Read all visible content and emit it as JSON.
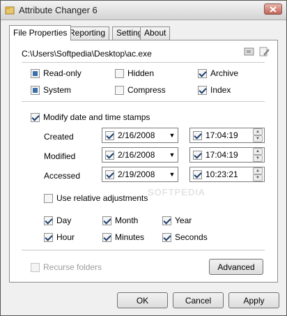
{
  "window": {
    "title": "Attribute Changer 6"
  },
  "tabs": [
    {
      "label": "File Properties",
      "active": true
    },
    {
      "label": "Reporting"
    },
    {
      "label": "Settings"
    },
    {
      "label": "About"
    }
  ],
  "file_path": "C:\\Users\\Softpedia\\Desktop\\ac.exe",
  "attributes": {
    "read_only": "Read-only",
    "hidden": "Hidden",
    "archive": "Archive",
    "system": "System",
    "compress": "Compress",
    "index": "Index"
  },
  "timestamps": {
    "modify_label": "Modify date and time stamps",
    "created": {
      "label": "Created",
      "date": "2/16/2008",
      "time": "17:04:19"
    },
    "modified": {
      "label": "Modified",
      "date": "2/16/2008",
      "time": "17:04:19"
    },
    "accessed": {
      "label": "Accessed",
      "date": "2/19/2008",
      "time": "10:23:21"
    },
    "relative_label": "Use relative adjustments",
    "units": {
      "day": "Day",
      "month": "Month",
      "year": "Year",
      "hour": "Hour",
      "minutes": "Minutes",
      "seconds": "Seconds"
    }
  },
  "recurse_label": "Recurse folders",
  "advanced_label": "Advanced",
  "watermark": "SOFTPEDIA",
  "footer": {
    "ok": "OK",
    "cancel": "Cancel",
    "apply": "Apply"
  }
}
